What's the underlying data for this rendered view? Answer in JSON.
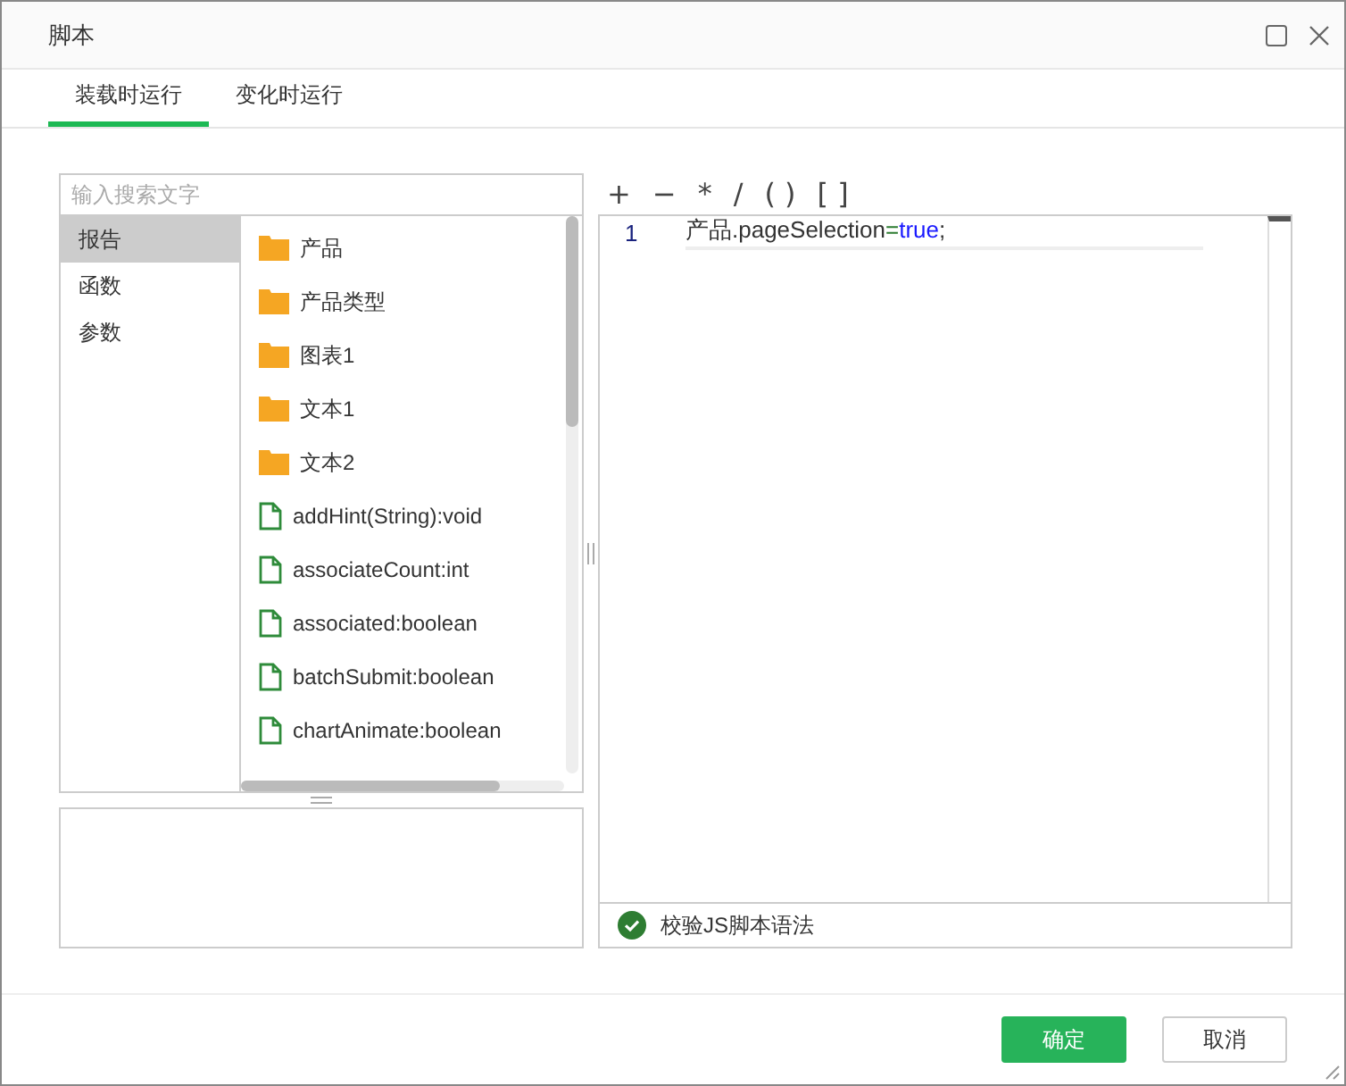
{
  "window": {
    "title": "脚本"
  },
  "tabs": [
    {
      "label": "装载时运行",
      "selected": true
    },
    {
      "label": "变化时运行",
      "selected": false
    }
  ],
  "search": {
    "placeholder": "输入搜索文字"
  },
  "categories": [
    {
      "label": "报告",
      "selected": true
    },
    {
      "label": "函数",
      "selected": false
    },
    {
      "label": "参数",
      "selected": false
    }
  ],
  "members": [
    {
      "label": "产品",
      "kind": "folder"
    },
    {
      "label": "产品类型",
      "kind": "folder"
    },
    {
      "label": "图表1",
      "kind": "folder"
    },
    {
      "label": "文本1",
      "kind": "folder"
    },
    {
      "label": "文本2",
      "kind": "folder"
    },
    {
      "label": "addHint(String):void",
      "kind": "method"
    },
    {
      "label": "associateCount:int",
      "kind": "method"
    },
    {
      "label": "associated:boolean",
      "kind": "method"
    },
    {
      "label": "batchSubmit:boolean",
      "kind": "method"
    },
    {
      "label": "chartAnimate:boolean",
      "kind": "method"
    }
  ],
  "operators": [
    "+",
    "−",
    "*",
    "/",
    "( )",
    "[ ]"
  ],
  "code_lines": [
    {
      "number": "1",
      "tokens": [
        {
          "text": "产品.pageSelection",
          "kind": "plain"
        },
        {
          "text": "=",
          "kind": "operator"
        },
        {
          "text": "true",
          "kind": "keyword"
        },
        {
          "text": ";",
          "kind": "plain"
        }
      ]
    }
  ],
  "validate": {
    "label": "校验JS脚本语法",
    "ok": true
  },
  "buttons": [
    {
      "label": "确定",
      "kind": "primary"
    },
    {
      "label": "取消",
      "kind": "secondary"
    }
  ]
}
